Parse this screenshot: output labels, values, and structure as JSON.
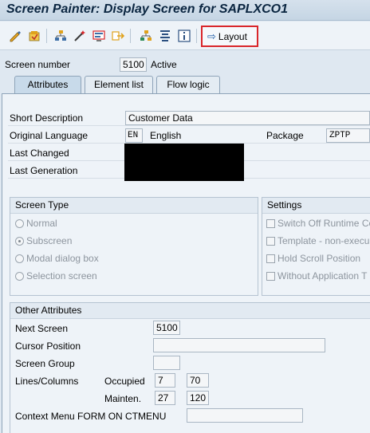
{
  "title": "Screen Painter: Display Screen for SAPLXCO1",
  "toolbar": {
    "icons": [
      "change-display-icon",
      "activate-icon",
      "hierarchy-icon",
      "magic-wand-icon",
      "screen-icon",
      "move-icon",
      "element-tree-icon",
      "align-icon",
      "info-icon"
    ],
    "layout_label": "Layout"
  },
  "screen": {
    "number_label": "Screen number",
    "number": "5100",
    "status": "Active"
  },
  "tabs": [
    {
      "label": "Attributes",
      "active": true
    },
    {
      "label": "Element list",
      "active": false
    },
    {
      "label": "Flow logic",
      "active": false
    }
  ],
  "attributes": {
    "short_desc_label": "Short Description",
    "short_desc": "Customer Data",
    "orig_lang_label": "Original Language",
    "orig_lang_code": "EN",
    "orig_lang_name": "English",
    "package_label": "Package",
    "package": "ZPTP",
    "last_changed_label": "Last Changed",
    "last_generation_label": "Last Generation"
  },
  "screen_type": {
    "header": "Screen Type",
    "options": [
      {
        "label": "Normal",
        "selected": false
      },
      {
        "label": "Subscreen",
        "selected": true
      },
      {
        "label": "Modal dialog box",
        "selected": false
      },
      {
        "label": "Selection screen",
        "selected": false
      }
    ]
  },
  "settings": {
    "header": "Settings",
    "options": [
      {
        "label": "Switch Off Runtime Co"
      },
      {
        "label": "Template - non-execu"
      },
      {
        "label": "Hold Scroll Position"
      },
      {
        "label": "Without Application T"
      }
    ]
  },
  "other": {
    "header": "Other Attributes",
    "next_screen_label": "Next Screen",
    "next_screen": "5100",
    "cursor_label": "Cursor Position",
    "cursor": "",
    "screen_group_label": "Screen Group",
    "screen_group": "",
    "lines_cols_label": "Lines/Columns",
    "occupied_label": "Occupied",
    "occupied_lines": "7",
    "occupied_cols": "70",
    "mainten_label": "Mainten.",
    "mainten_lines": "27",
    "mainten_cols": "120",
    "context_menu_label": "Context Menu FORM ON CTMENU",
    "context_menu": ""
  }
}
